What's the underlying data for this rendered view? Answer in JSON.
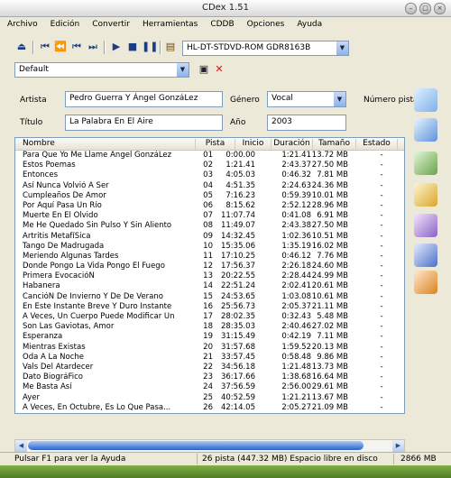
{
  "window": {
    "title": "CDex 1.51"
  },
  "menu": [
    "Archivo",
    "Edición",
    "Convertir",
    "Herramientas",
    "CDDB",
    "Opciones",
    "Ayuda"
  ],
  "toolbar": {
    "drive": "HL-DT-STDVD-ROM GDR8163B"
  },
  "preset": {
    "value": "Default"
  },
  "album": {
    "artist_label": "Artista",
    "artist": "Pedro Guerra Y Ángel GonzáLez",
    "title_label": "Título",
    "title": "La Palabra En El Aire",
    "genre_label": "Género",
    "genre": "Vocal",
    "year_label": "Año",
    "year": "2003",
    "track_number_label": "Número pista"
  },
  "table": {
    "columns": [
      "Nombre",
      "Pista",
      "Inicio",
      "Duración",
      "Tamaño",
      "Estado"
    ],
    "rows": [
      {
        "name": "Para Que Yo Me Llame Ángel GonzáLez",
        "track": "01",
        "start": "0:00.00",
        "duration": "1:21.41",
        "size": "13.72 MB",
        "status": "-"
      },
      {
        "name": "Estos Poemas",
        "track": "02",
        "start": "1:21.41",
        "duration": "2:43.37",
        "size": "27.50 MB",
        "status": "-"
      },
      {
        "name": "Entonces",
        "track": "03",
        "start": "4:05.03",
        "duration": "0:46.32",
        "size": "7.81 MB",
        "status": "-"
      },
      {
        "name": "Así Nunca Volvió A Ser",
        "track": "04",
        "start": "4:51.35",
        "duration": "2:24.63",
        "size": "24.36 MB",
        "status": "-"
      },
      {
        "name": "Cumpleaños De Amor",
        "track": "05",
        "start": "7:16.23",
        "duration": "0:59.39",
        "size": "10.01 MB",
        "status": "-"
      },
      {
        "name": "Por Aquí Pasa Un Río",
        "track": "06",
        "start": "8:15.62",
        "duration": "2:52.12",
        "size": "28.96 MB",
        "status": "-"
      },
      {
        "name": "Muerte En El Olvido",
        "track": "07",
        "start": "11:07.74",
        "duration": "0:41.08",
        "size": "6.91 MB",
        "status": "-"
      },
      {
        "name": "Me He Quedado Sin Pulso Y Sin Aliento",
        "track": "08",
        "start": "11:49.07",
        "duration": "2:43.38",
        "size": "27.50 MB",
        "status": "-"
      },
      {
        "name": "Artritis MetafíSica",
        "track": "09",
        "start": "14:32.45",
        "duration": "1:02.36",
        "size": "10.51 MB",
        "status": "-"
      },
      {
        "name": "Tango De Madrugada",
        "track": "10",
        "start": "15:35.06",
        "duration": "1:35.19",
        "size": "16.02 MB",
        "status": "-"
      },
      {
        "name": "Meriendo Algunas Tardes",
        "track": "11",
        "start": "17:10.25",
        "duration": "0:46.12",
        "size": "7.76 MB",
        "status": "-"
      },
      {
        "name": "Donde Pongo La Vida Pongo El Fuego",
        "track": "12",
        "start": "17:56.37",
        "duration": "2:26.18",
        "size": "24.60 MB",
        "status": "-"
      },
      {
        "name": "Primera EvocacióN",
        "track": "13",
        "start": "20:22.55",
        "duration": "2:28.44",
        "size": "24.99 MB",
        "status": "-"
      },
      {
        "name": "Habanera",
        "track": "14",
        "start": "22:51.24",
        "duration": "2:02.41",
        "size": "20.61 MB",
        "status": "-"
      },
      {
        "name": "CancióN De Invierno Y De De Verano",
        "track": "15",
        "start": "24:53.65",
        "duration": "1:03.08",
        "size": "10.61 MB",
        "status": "-"
      },
      {
        "name": "En Este Instante Breve Y Duro Instante",
        "track": "16",
        "start": "25:56.73",
        "duration": "2:05.37",
        "size": "21.11 MB",
        "status": "-"
      },
      {
        "name": "A Veces, Un Cuerpo Puede Modificar Un ...",
        "track": "17",
        "start": "28:02.35",
        "duration": "0:32.43",
        "size": "5.48 MB",
        "status": "-"
      },
      {
        "name": "Son Las Gaviotas, Amor",
        "track": "18",
        "start": "28:35.03",
        "duration": "2:40.46",
        "size": "27.02 MB",
        "status": "-"
      },
      {
        "name": "Esperanza",
        "track": "19",
        "start": "31:15.49",
        "duration": "0:42.19",
        "size": "7.11 MB",
        "status": "-"
      },
      {
        "name": "Mientras Existas",
        "track": "20",
        "start": "31:57.68",
        "duration": "1:59.52",
        "size": "20.13 MB",
        "status": "-"
      },
      {
        "name": "Oda A La Noche",
        "track": "21",
        "start": "33:57.45",
        "duration": "0:58.48",
        "size": "9.86 MB",
        "status": "-"
      },
      {
        "name": "Vals Del Atardecer",
        "track": "22",
        "start": "34:56.18",
        "duration": "1:21.48",
        "size": "13.73 MB",
        "status": "-"
      },
      {
        "name": "Dato BiográFico",
        "track": "23",
        "start": "36:17.66",
        "duration": "1:38.68",
        "size": "16.64 MB",
        "status": "-"
      },
      {
        "name": "Me Basta Así",
        "track": "24",
        "start": "37:56.59",
        "duration": "2:56.00",
        "size": "29.61 MB",
        "status": "-"
      },
      {
        "name": "Ayer",
        "track": "25",
        "start": "40:52.59",
        "duration": "1:21.21",
        "size": "13.67 MB",
        "status": "-"
      },
      {
        "name": "A Veces, En Octubre, Es Lo Que Pasa...",
        "track": "26",
        "start": "42:14.05",
        "duration": "2:05.27",
        "size": "21.09 MB",
        "status": "-"
      }
    ]
  },
  "statusbar": {
    "help": "Pulsar F1 para ver la Ayuda",
    "tracks": "26 pista (447.32 MB) Espacio libre en disco",
    "free": "2866 MB"
  }
}
